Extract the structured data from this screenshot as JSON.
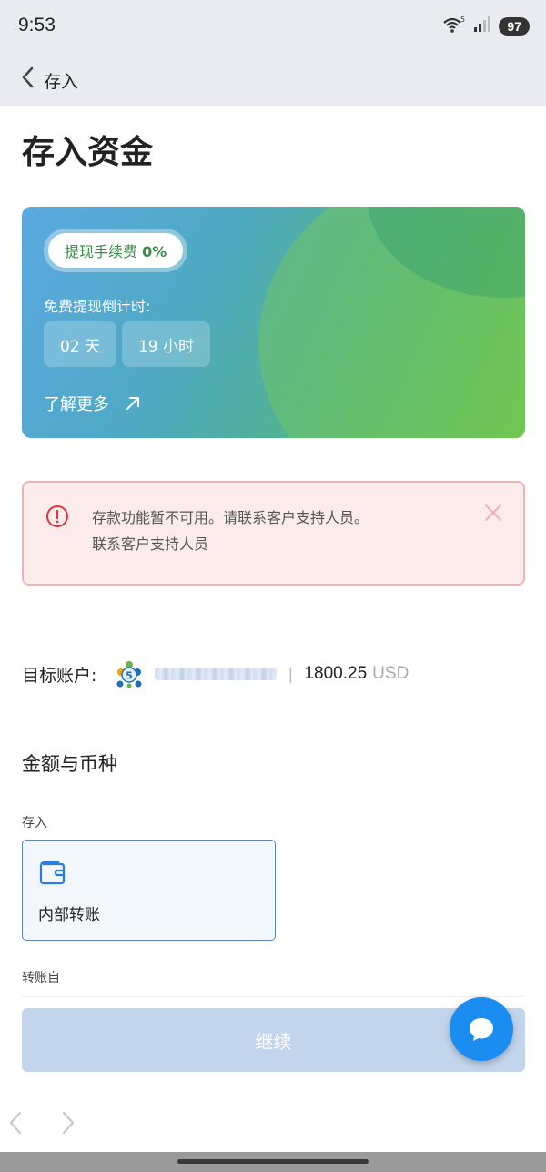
{
  "status_bar": {
    "time": "9:53",
    "signal_label": "5",
    "battery": "97"
  },
  "app_bar": {
    "title": "存入"
  },
  "page": {
    "title": "存入资金"
  },
  "promo": {
    "fee_label": "提现手续费",
    "fee_value": "0%",
    "countdown_label": "免费提现倒计时:",
    "days": "02 天",
    "hours": "19 小时",
    "learn_more": "了解更多"
  },
  "alert": {
    "line1": "存款功能暂不可用。请联系客户支持人员。",
    "line2": "联系客户支持人员"
  },
  "target": {
    "label": "目标账户:",
    "badge": "5",
    "separator": "|",
    "balance": "1800.25",
    "currency": "USD"
  },
  "amount_section": {
    "title": "金额与币种",
    "deposit_label": "存入",
    "method": "内部转账",
    "transfer_from_label": "转账自"
  },
  "actions": {
    "continue": "继续"
  }
}
